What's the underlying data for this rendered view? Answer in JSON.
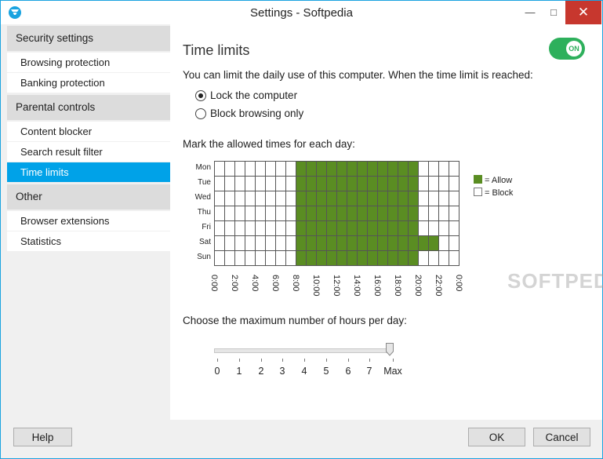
{
  "window": {
    "title": "Settings - Softpedia"
  },
  "sidebar": {
    "sections": [
      {
        "label": "Security settings",
        "items": [
          "Browsing protection",
          "Banking protection"
        ]
      },
      {
        "label": "Parental controls",
        "items": [
          "Content blocker",
          "Search result filter",
          "Time limits"
        ]
      },
      {
        "label": "Other",
        "items": [
          "Browser extensions",
          "Statistics"
        ]
      }
    ],
    "active_item": "Time limits"
  },
  "main": {
    "title": "Time limits",
    "toggle_label": "ON",
    "toggle_on": true,
    "description": "You can limit the daily use of this computer. When the time limit is reached:",
    "radio_options": [
      "Lock the computer",
      "Block browsing only"
    ],
    "radio_selected": 0,
    "grid_label": "Mark the allowed times for each day:",
    "schedule": {
      "days": [
        "Mon",
        "Tue",
        "Wed",
        "Thu",
        "Fri",
        "Sat",
        "Sun"
      ],
      "time_labels": [
        "0:00",
        "2:00",
        "4:00",
        "6:00",
        "8:00",
        "10:00",
        "12:00",
        "14:00",
        "16:00",
        "18:00",
        "20:00",
        "22:00",
        "0:00"
      ],
      "allowed_hours": [
        [
          8,
          20
        ],
        [
          8,
          20
        ],
        [
          8,
          20
        ],
        [
          8,
          20
        ],
        [
          8,
          20
        ],
        [
          8,
          22
        ],
        [
          8,
          20
        ]
      ],
      "legend": [
        {
          "label": "= Allow",
          "color": "#5a8d22"
        },
        {
          "label": "= Block",
          "color": "#ffffff"
        }
      ]
    },
    "hours_label": "Choose the maximum number of hours per day:",
    "slider_ticks": [
      "0",
      "1",
      "2",
      "3",
      "4",
      "5",
      "6",
      "7",
      "Max"
    ],
    "slider_value": "Max"
  },
  "footer": {
    "help": "Help",
    "ok": "OK",
    "cancel": "Cancel"
  },
  "watermark": "SOFTPEDIA",
  "colors": {
    "accent": "#00a2e8",
    "toggle": "#2eb05c",
    "allow": "#5a8d22",
    "close": "#c7372e"
  }
}
